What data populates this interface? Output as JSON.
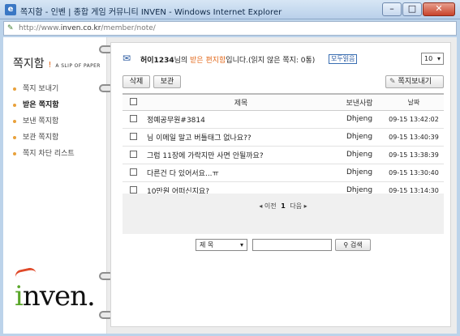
{
  "window": {
    "title": "쪽지함 - 인벤 | 종합 게임 커뮤니티 INVEN - Windows Internet Explorer",
    "url_prefix": "http://www.",
    "url_host": "inven.co.kr",
    "url_path": "/member/note/",
    "minimize": "–",
    "maximize": "□",
    "close": "✕"
  },
  "sidebar": {
    "brand_ko": "쪽지함",
    "brand_sep": "!",
    "brand_en": "A SLIP OF PAPER",
    "items": [
      {
        "label": "쪽지 보내기"
      },
      {
        "label": "받은 쪽지함"
      },
      {
        "label": "보낸 쪽지함"
      },
      {
        "label": "보관 쪽지함"
      },
      {
        "label": "쪽지 차단 리스트"
      }
    ],
    "logo_i": "i",
    "logo_rest": "nven",
    "logo_dot": "."
  },
  "status": {
    "user": "허이1234",
    "mid1": "님의 ",
    "box": "받은 편지함",
    "mid2": "입니다.(읽지 않은 쪽지: 0통)",
    "mark_all": "모두읽음"
  },
  "page_size": {
    "value": "10"
  },
  "actions": {
    "delete": "삭제",
    "save": "보관",
    "write": "쪽지보내기"
  },
  "table": {
    "headers": {
      "title": "제목",
      "sender": "보낸사람",
      "date": "날짜"
    },
    "rows": [
      {
        "title": "정예공무원#3814",
        "sender": "Dhjeng",
        "date": "09-15 13:42:02"
      },
      {
        "title": "님 이메일 말고 버틀태그 없나요??",
        "sender": "Dhjeng",
        "date": "09-15 13:40:39"
      },
      {
        "title": "그럼 11장에 가락지만 사면 안될까요?",
        "sender": "Dhjeng",
        "date": "09-15 13:38:39"
      },
      {
        "title": "다른건 다 있어서요...ㅠ",
        "sender": "Dhjeng",
        "date": "09-15 13:30:40"
      },
      {
        "title": "10만원 어떠신지요?",
        "sender": "Dhjeng",
        "date": "09-15 13:14:30"
      }
    ]
  },
  "pager": {
    "prev": "◂ 이전",
    "current": "1",
    "next": "다음 ▸"
  },
  "search": {
    "field": "제 목",
    "query": "",
    "button": "검색"
  }
}
